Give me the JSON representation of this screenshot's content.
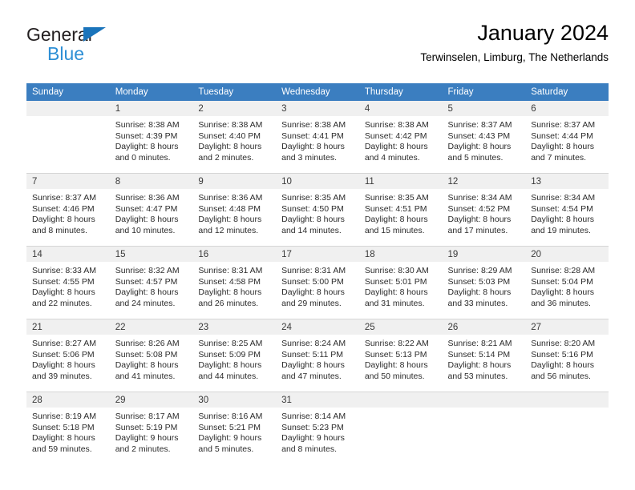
{
  "brand": {
    "line1": "General",
    "line2": "Blue",
    "triangle_color": "#1a74bb",
    "line2_color": "#2d8fd5"
  },
  "header": {
    "title": "January 2024",
    "subtitle": "Terwinselen, Limburg, The Netherlands"
  },
  "theme": {
    "header_row_bg": "#3b7ec0",
    "header_row_text": "#ffffff",
    "daynum_bg": "#f0f0f0",
    "grid_line": "#d6d6d6"
  },
  "calendar": {
    "weekday_headers": [
      "Sunday",
      "Monday",
      "Tuesday",
      "Wednesday",
      "Thursday",
      "Friday",
      "Saturday"
    ],
    "weeks": [
      [
        {
          "day": "",
          "lines": [
            "",
            "",
            "",
            ""
          ]
        },
        {
          "day": "1",
          "lines": [
            "Sunrise: 8:38 AM",
            "Sunset: 4:39 PM",
            "Daylight: 8 hours",
            "and 0 minutes."
          ]
        },
        {
          "day": "2",
          "lines": [
            "Sunrise: 8:38 AM",
            "Sunset: 4:40 PM",
            "Daylight: 8 hours",
            "and 2 minutes."
          ]
        },
        {
          "day": "3",
          "lines": [
            "Sunrise: 8:38 AM",
            "Sunset: 4:41 PM",
            "Daylight: 8 hours",
            "and 3 minutes."
          ]
        },
        {
          "day": "4",
          "lines": [
            "Sunrise: 8:38 AM",
            "Sunset: 4:42 PM",
            "Daylight: 8 hours",
            "and 4 minutes."
          ]
        },
        {
          "day": "5",
          "lines": [
            "Sunrise: 8:37 AM",
            "Sunset: 4:43 PM",
            "Daylight: 8 hours",
            "and 5 minutes."
          ]
        },
        {
          "day": "6",
          "lines": [
            "Sunrise: 8:37 AM",
            "Sunset: 4:44 PM",
            "Daylight: 8 hours",
            "and 7 minutes."
          ]
        }
      ],
      [
        {
          "day": "7",
          "lines": [
            "Sunrise: 8:37 AM",
            "Sunset: 4:46 PM",
            "Daylight: 8 hours",
            "and 8 minutes."
          ]
        },
        {
          "day": "8",
          "lines": [
            "Sunrise: 8:36 AM",
            "Sunset: 4:47 PM",
            "Daylight: 8 hours",
            "and 10 minutes."
          ]
        },
        {
          "day": "9",
          "lines": [
            "Sunrise: 8:36 AM",
            "Sunset: 4:48 PM",
            "Daylight: 8 hours",
            "and 12 minutes."
          ]
        },
        {
          "day": "10",
          "lines": [
            "Sunrise: 8:35 AM",
            "Sunset: 4:50 PM",
            "Daylight: 8 hours",
            "and 14 minutes."
          ]
        },
        {
          "day": "11",
          "lines": [
            "Sunrise: 8:35 AM",
            "Sunset: 4:51 PM",
            "Daylight: 8 hours",
            "and 15 minutes."
          ]
        },
        {
          "day": "12",
          "lines": [
            "Sunrise: 8:34 AM",
            "Sunset: 4:52 PM",
            "Daylight: 8 hours",
            "and 17 minutes."
          ]
        },
        {
          "day": "13",
          "lines": [
            "Sunrise: 8:34 AM",
            "Sunset: 4:54 PM",
            "Daylight: 8 hours",
            "and 19 minutes."
          ]
        }
      ],
      [
        {
          "day": "14",
          "lines": [
            "Sunrise: 8:33 AM",
            "Sunset: 4:55 PM",
            "Daylight: 8 hours",
            "and 22 minutes."
          ]
        },
        {
          "day": "15",
          "lines": [
            "Sunrise: 8:32 AM",
            "Sunset: 4:57 PM",
            "Daylight: 8 hours",
            "and 24 minutes."
          ]
        },
        {
          "day": "16",
          "lines": [
            "Sunrise: 8:31 AM",
            "Sunset: 4:58 PM",
            "Daylight: 8 hours",
            "and 26 minutes."
          ]
        },
        {
          "day": "17",
          "lines": [
            "Sunrise: 8:31 AM",
            "Sunset: 5:00 PM",
            "Daylight: 8 hours",
            "and 29 minutes."
          ]
        },
        {
          "day": "18",
          "lines": [
            "Sunrise: 8:30 AM",
            "Sunset: 5:01 PM",
            "Daylight: 8 hours",
            "and 31 minutes."
          ]
        },
        {
          "day": "19",
          "lines": [
            "Sunrise: 8:29 AM",
            "Sunset: 5:03 PM",
            "Daylight: 8 hours",
            "and 33 minutes."
          ]
        },
        {
          "day": "20",
          "lines": [
            "Sunrise: 8:28 AM",
            "Sunset: 5:04 PM",
            "Daylight: 8 hours",
            "and 36 minutes."
          ]
        }
      ],
      [
        {
          "day": "21",
          "lines": [
            "Sunrise: 8:27 AM",
            "Sunset: 5:06 PM",
            "Daylight: 8 hours",
            "and 39 minutes."
          ]
        },
        {
          "day": "22",
          "lines": [
            "Sunrise: 8:26 AM",
            "Sunset: 5:08 PM",
            "Daylight: 8 hours",
            "and 41 minutes."
          ]
        },
        {
          "day": "23",
          "lines": [
            "Sunrise: 8:25 AM",
            "Sunset: 5:09 PM",
            "Daylight: 8 hours",
            "and 44 minutes."
          ]
        },
        {
          "day": "24",
          "lines": [
            "Sunrise: 8:24 AM",
            "Sunset: 5:11 PM",
            "Daylight: 8 hours",
            "and 47 minutes."
          ]
        },
        {
          "day": "25",
          "lines": [
            "Sunrise: 8:22 AM",
            "Sunset: 5:13 PM",
            "Daylight: 8 hours",
            "and 50 minutes."
          ]
        },
        {
          "day": "26",
          "lines": [
            "Sunrise: 8:21 AM",
            "Sunset: 5:14 PM",
            "Daylight: 8 hours",
            "and 53 minutes."
          ]
        },
        {
          "day": "27",
          "lines": [
            "Sunrise: 8:20 AM",
            "Sunset: 5:16 PM",
            "Daylight: 8 hours",
            "and 56 minutes."
          ]
        }
      ],
      [
        {
          "day": "28",
          "lines": [
            "Sunrise: 8:19 AM",
            "Sunset: 5:18 PM",
            "Daylight: 8 hours",
            "and 59 minutes."
          ]
        },
        {
          "day": "29",
          "lines": [
            "Sunrise: 8:17 AM",
            "Sunset: 5:19 PM",
            "Daylight: 9 hours",
            "and 2 minutes."
          ]
        },
        {
          "day": "30",
          "lines": [
            "Sunrise: 8:16 AM",
            "Sunset: 5:21 PM",
            "Daylight: 9 hours",
            "and 5 minutes."
          ]
        },
        {
          "day": "31",
          "lines": [
            "Sunrise: 8:14 AM",
            "Sunset: 5:23 PM",
            "Daylight: 9 hours",
            "and 8 minutes."
          ]
        },
        {
          "day": "",
          "lines": [
            "",
            "",
            "",
            ""
          ]
        },
        {
          "day": "",
          "lines": [
            "",
            "",
            "",
            ""
          ]
        },
        {
          "day": "",
          "lines": [
            "",
            "",
            "",
            ""
          ]
        }
      ]
    ]
  }
}
